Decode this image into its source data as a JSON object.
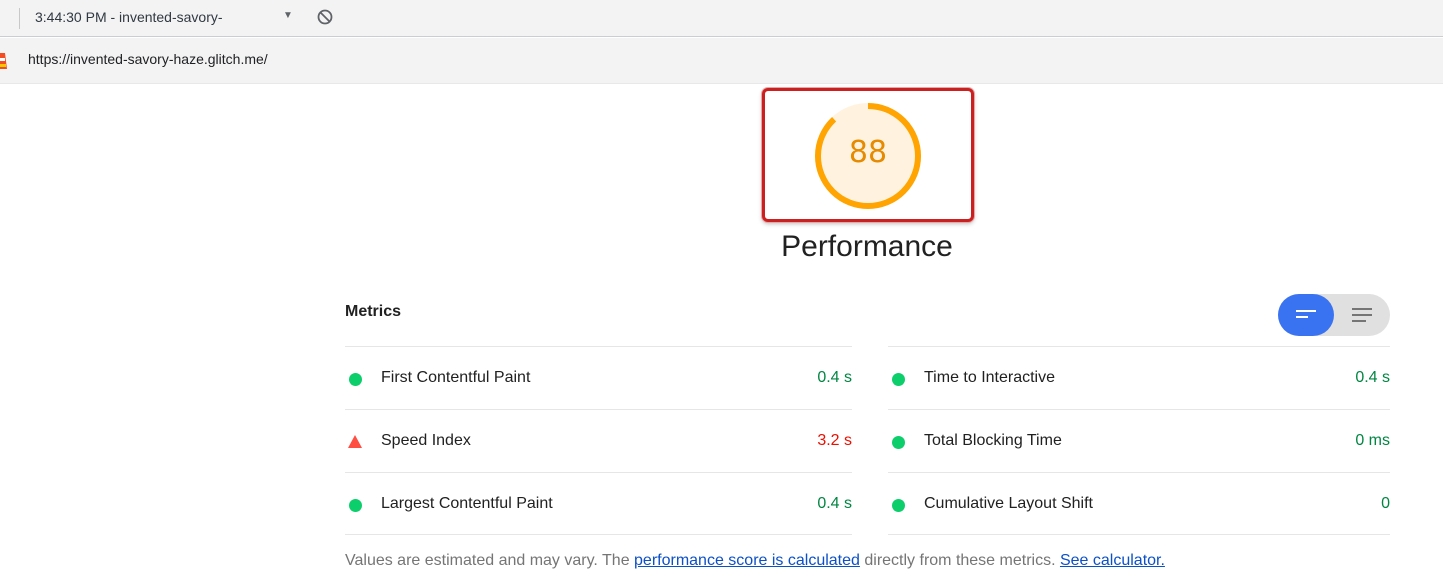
{
  "toolbar": {
    "session": "3:44:30 PM - invented-savory-",
    "dropdown_glyph": "▼",
    "clear_icon": "block-icon"
  },
  "urlbar": {
    "url": "https://invented-savory-haze.glitch.me/"
  },
  "score": {
    "value": "88",
    "fraction": 0.88,
    "color": "#ffa400",
    "title": "Performance"
  },
  "metrics": {
    "header": "Metrics",
    "left": [
      {
        "label": "First Contentful Paint",
        "value": "0.4 s",
        "status": "pass"
      },
      {
        "label": "Speed Index",
        "value": "3.2 s",
        "status": "fail"
      },
      {
        "label": "Largest Contentful Paint",
        "value": "0.4 s",
        "status": "pass"
      }
    ],
    "right": [
      {
        "label": "Time to Interactive",
        "value": "0.4 s",
        "status": "pass"
      },
      {
        "label": "Total Blocking Time",
        "value": "0 ms",
        "status": "pass"
      },
      {
        "label": "Cumulative Layout Shift",
        "value": "0",
        "status": "pass"
      }
    ]
  },
  "footnote": {
    "prefix": "Values are estimated and may vary. The ",
    "link1": "performance score is calculated",
    "middle": " directly from these metrics. ",
    "link2": "See calculator."
  },
  "colors": {
    "pass": "#0cce6b",
    "fail": "#ff4e42",
    "toggle_active": "#3a73f2"
  }
}
